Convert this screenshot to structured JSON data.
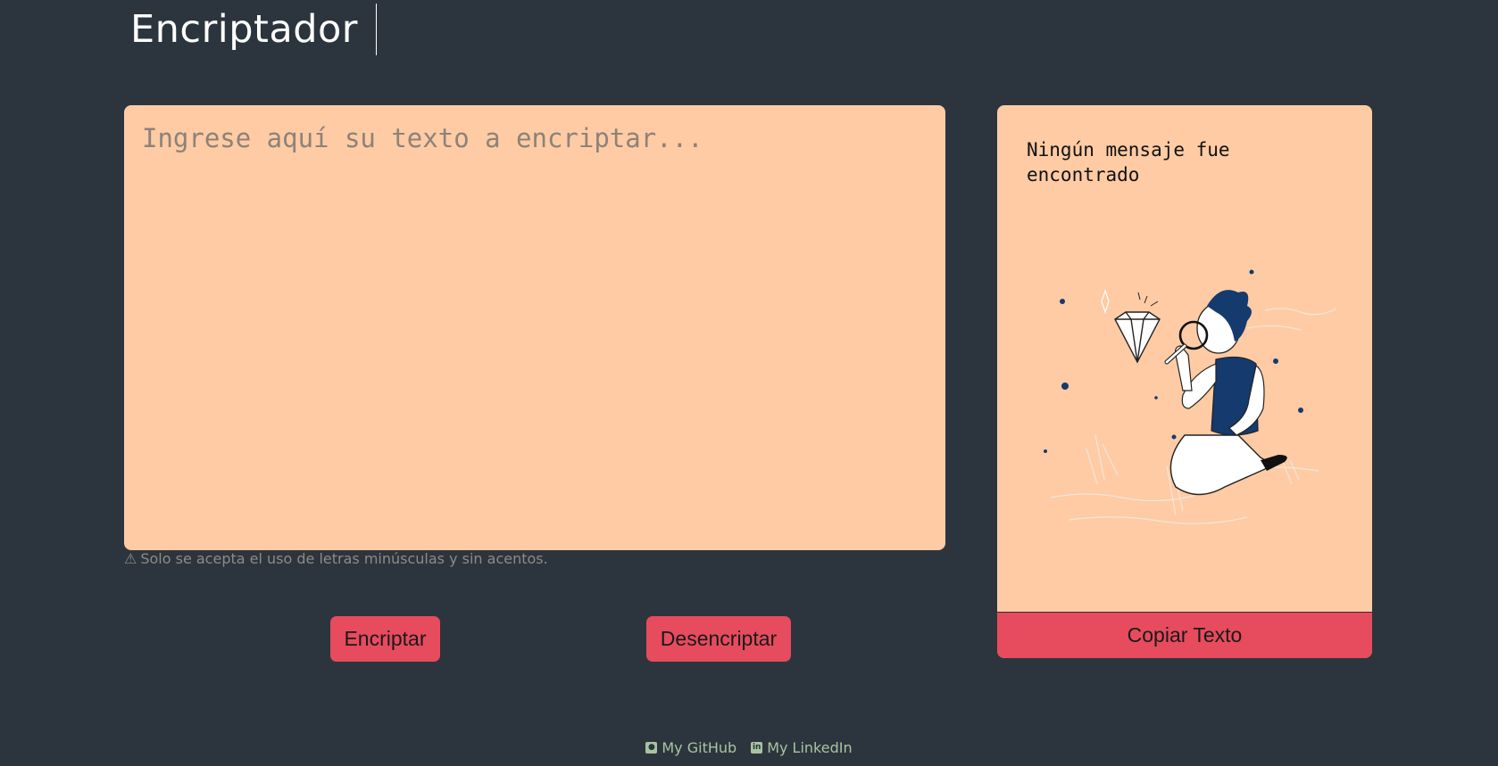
{
  "header": {
    "title": "Encriptador"
  },
  "input": {
    "placeholder": "Ingrese aquí su texto a encriptar...",
    "value": ""
  },
  "hint": {
    "icon": "warning-icon",
    "text": "Solo se acepta el uso de letras minúsculas y sin acentos."
  },
  "buttons": {
    "encrypt_label": "Encriptar",
    "decrypt_label": "Desencriptar"
  },
  "output": {
    "message": "Ningún mensaje fue encontrado",
    "illustration": "person-searching-diamond-illustration",
    "copy_label": "Copiar Texto"
  },
  "footer": {
    "github_label": "My GitHub",
    "linkedin_label": "My LinkedIn"
  },
  "colors": {
    "background": "#2c353d",
    "panel": "#fecba4",
    "accent": "#e64b5e",
    "footer_link": "#a7c4a1"
  }
}
